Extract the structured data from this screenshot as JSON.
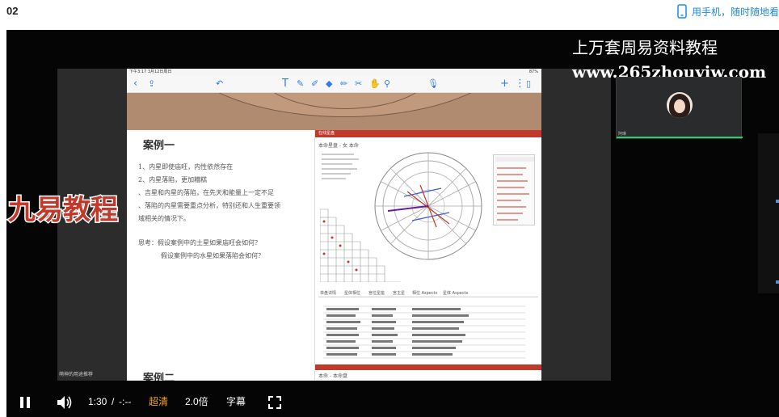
{
  "header": {
    "episode": "02",
    "phone_cta": "用手机，随时随地看"
  },
  "colors": {
    "accent_blue": "#1e88e5",
    "hd_orange": "#f5a623",
    "astro_red": "#c0392b",
    "watermark_red": "#c0392b"
  },
  "video": {
    "ipad_status": {
      "time": "下午3:17  3月12日周日",
      "battery": "87%"
    },
    "toolbar_icons": [
      "chevron-left-icon",
      "share-icon",
      "undo-icon",
      "text-icon",
      "pen-icon",
      "pencil-icon",
      "eraser-icon",
      "highlighter-icon",
      "scissors-icon",
      "lasso-icon",
      "hand-icon",
      "mic-icon",
      "plus-icon",
      "more-icon",
      "page-icon"
    ],
    "note": {
      "case_title": "案例一",
      "lines": [
        "1、内星即使庙旺，内性依然存在",
        "2、内星落陷，更加糟糕",
        "、吉星和内星的落陷，在先天和能量上一定不足",
        "、落陷的内星需要重点分析，特别还和人生重要领",
        "域相关的情况下。",
        "思考：假设案例中的土星如果庙旺会如何？",
        "假设案例中的水星如果落陷会如何？"
      ],
      "case2_title": "案例二"
    },
    "astro_web": {
      "header_text": "在线星盘",
      "subtitle": "本命星盘 - 女 本命",
      "tabs": [
        "单盘详情",
        "星体相位",
        "宫位星座",
        "宫主星",
        "相位 Aspects",
        "星体 Aspects"
      ],
      "bottom_subtitle": "本命 - 本命盘"
    },
    "watermark_label": "九易教程",
    "watermark_top": "上万套周易资料教程",
    "watermark_url": "www.265zhouyiw.com",
    "sidebar_caption": "萌神的用途推荐",
    "cam_name": "阿琳"
  },
  "controls": {
    "play_state": "pause",
    "time_current": "1:30",
    "time_sep": "/",
    "time_total": "-:--",
    "quality": "超清",
    "speed": "2.0倍",
    "subtitles": "字幕"
  }
}
